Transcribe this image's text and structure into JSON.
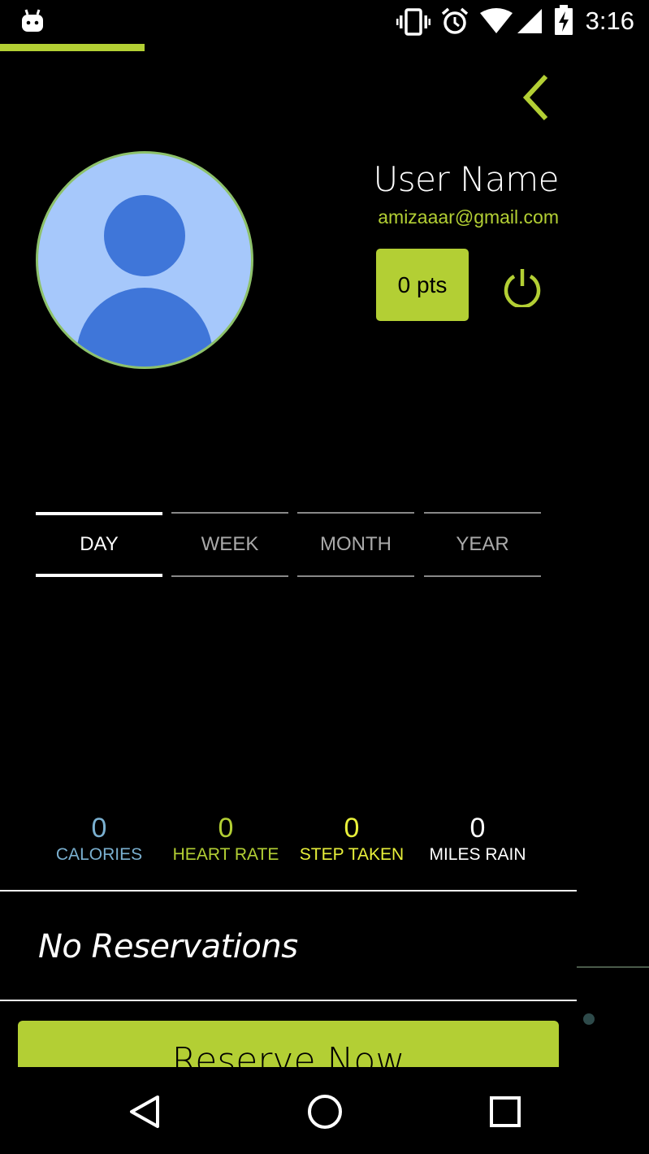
{
  "status_bar": {
    "time": "3:16",
    "icons": [
      "android-icon",
      "vibrate-icon",
      "alarm-icon",
      "wifi-icon",
      "signal-icon",
      "battery-charging-icon"
    ]
  },
  "header": {
    "back_icon": "chevron-left-icon"
  },
  "profile": {
    "name": "User Name",
    "email": "amizaaar@gmail.com",
    "points_label": "0 pts",
    "avatar_icon": "person-avatar-icon",
    "power_icon": "power-icon"
  },
  "tabs": [
    {
      "label": "DAY",
      "active": true
    },
    {
      "label": "WEEK",
      "active": false
    },
    {
      "label": "MONTH",
      "active": false
    },
    {
      "label": "YEAR",
      "active": false
    }
  ],
  "stats": [
    {
      "value": "0",
      "label": "CALORIES",
      "color": "#7ab0d0"
    },
    {
      "value": "0",
      "label": "HEART RATE",
      "color": "#b3cf34"
    },
    {
      "value": "0",
      "label": "STEP TAKEN",
      "color": "#e8f03a"
    },
    {
      "value": "0",
      "label": "MILES RAIN",
      "color": "#ffffff"
    }
  ],
  "reservations": {
    "empty_text": "No Reservations",
    "button_label": "Reserve Now"
  },
  "nav_bar": {
    "icons": [
      "back-triangle-icon",
      "home-circle-icon",
      "recents-square-icon"
    ]
  },
  "colors": {
    "accent": "#b3cf34",
    "background": "#000000",
    "avatar_bg": "#a6c8fb",
    "avatar_fg": "#3f76d9"
  }
}
